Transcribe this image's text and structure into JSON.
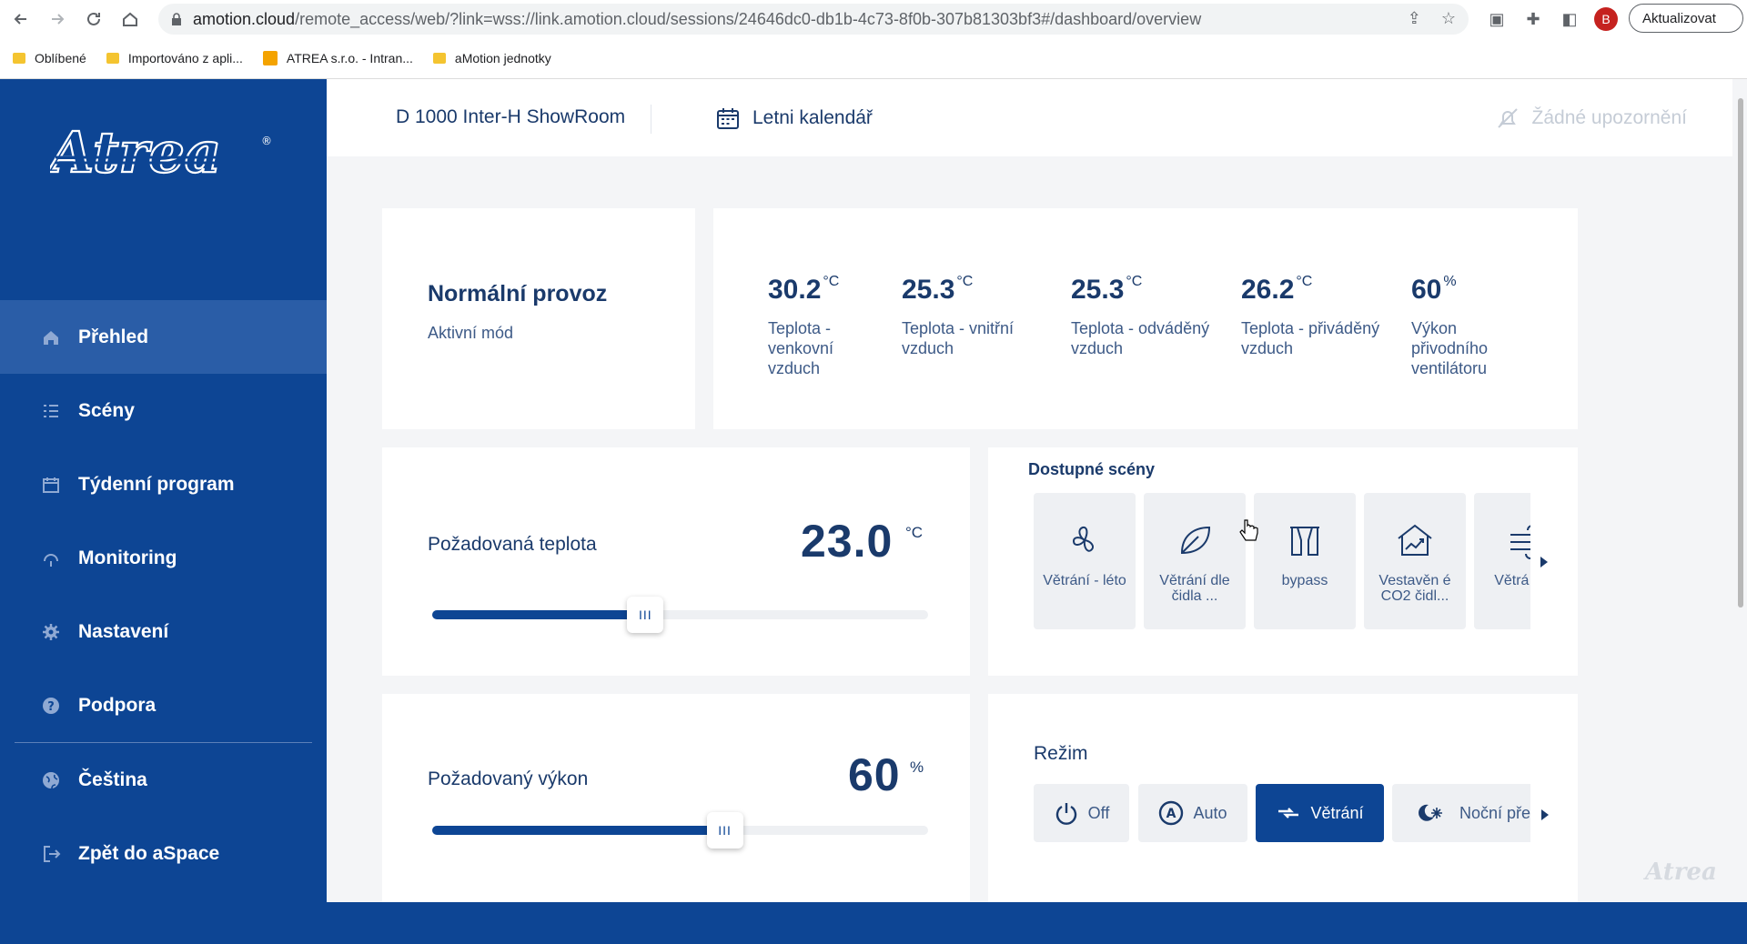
{
  "browser": {
    "url_host": "amotion.cloud",
    "url_path": "/remote_access/web/?link=wss://link.amotion.cloud/sessions/24646dc0-db1b-4c73-8f0b-307b81303bf3#/dashboard/overview",
    "profile_initial": "B",
    "update_label": "Aktualizovat",
    "bookmarks": [
      {
        "label": "Oblíbené"
      },
      {
        "label": "Importováno z apli..."
      },
      {
        "label": "ATREA s.r.o. - Intran..."
      },
      {
        "label": "aMotion jednotky"
      }
    ]
  },
  "sidebar": {
    "logo_text": "Atrea",
    "items": [
      {
        "label": "Přehled",
        "icon": "home-icon",
        "active": true
      },
      {
        "label": "Scény",
        "icon": "list-icon"
      },
      {
        "label": "Týdenní program",
        "icon": "calendar-icon"
      },
      {
        "label": "Monitoring",
        "icon": "gauge-icon"
      },
      {
        "label": "Nastavení",
        "icon": "gear-icon"
      },
      {
        "label": "Podpora",
        "icon": "help-icon"
      },
      {
        "label": "Čeština",
        "icon": "globe-icon"
      },
      {
        "label": "Zpět do aSpace",
        "icon": "exit-icon"
      }
    ]
  },
  "header": {
    "device_name": "D 1000 Inter-H ShowRoom",
    "calendar_label": "Letni kalendář",
    "alerts_label": "Žádné upozornění"
  },
  "mode_card": {
    "title": "Normální provoz",
    "subtitle": "Aktivní mód"
  },
  "sensors": [
    {
      "value": "30.2",
      "unit": "°C",
      "label": "Teplota - venkovní vzduch"
    },
    {
      "value": "25.3",
      "unit": "°C",
      "label": "Teplota - vnitřní vzduch"
    },
    {
      "value": "25.3",
      "unit": "°C",
      "label": "Teplota - odváděný vzduch"
    },
    {
      "value": "26.2",
      "unit": "°C",
      "label": "Teplota - přiváděný vzduch"
    },
    {
      "value": "60",
      "unit": "%",
      "label": "Výkon přivodního ventilátoru"
    }
  ],
  "temperature_control": {
    "label": "Požadovaná teplota",
    "value": "23.0",
    "unit": "°C",
    "slider_fraction": 0.43,
    "thumb_label": "III"
  },
  "power_control": {
    "label": "Požadovaný výkon",
    "value": "60",
    "unit": "%",
    "slider_fraction": 0.59,
    "thumb_label": "III"
  },
  "scenes": {
    "title": "Dostupné scény",
    "items": [
      {
        "label": "Větrání - léto",
        "icon": "fan-icon"
      },
      {
        "label": "Větrání dle čidla ...",
        "icon": "leaf-icon"
      },
      {
        "label": "bypass",
        "icon": "bypass-icon"
      },
      {
        "label": "Vestavěn é CO2 čidl...",
        "icon": "house-chart-icon"
      },
      {
        "label": "Větrá zim",
        "icon": "wind-icon"
      }
    ]
  },
  "rezim": {
    "title": "Režim",
    "items": [
      {
        "label": "Off",
        "icon": "power-icon"
      },
      {
        "label": "Auto",
        "icon": "auto-icon"
      },
      {
        "label": "Větrání",
        "icon": "ventilation-icon",
        "active": true
      },
      {
        "label": "Noční pře",
        "icon": "night-icon"
      }
    ]
  },
  "watermark": "Atrea",
  "colors": {
    "brand_blue": "#0d4594",
    "active_nav": "#2a5da7",
    "text_navy": "#1a3a6b",
    "content_bg": "#f4f5f7"
  }
}
